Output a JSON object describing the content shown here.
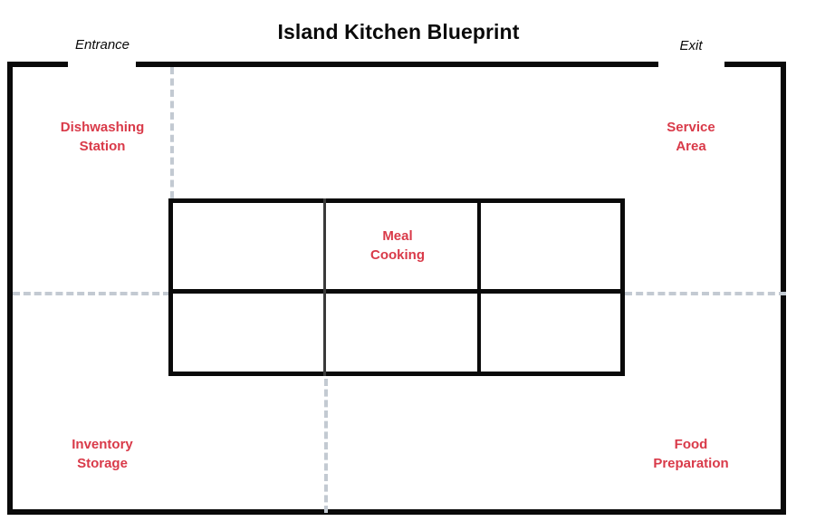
{
  "title": "Island Kitchen Blueprint",
  "doors": {
    "entrance": "Entrance",
    "exit": "Exit"
  },
  "zones": {
    "dishwashing": "Dishwashing\nStation",
    "service": "Service\nArea",
    "inventory": "Inventory\nStorage",
    "food_prep": "Food\nPreparation",
    "island_center": "Meal\nCooking"
  },
  "colors": {
    "zone_label": "#d93a49",
    "wall": "#0a0a0a",
    "divider_dash": "#c3cad2",
    "background": "#ffffff"
  },
  "diagram_data": {
    "type": "floorplan",
    "layout": "island-kitchen",
    "room": {
      "walls": 4,
      "door_openings": 2
    },
    "island": {
      "columns": 3,
      "rows": 2,
      "cells": 6,
      "labeled_cell": "Meal Cooking"
    },
    "zone_count": 5
  }
}
